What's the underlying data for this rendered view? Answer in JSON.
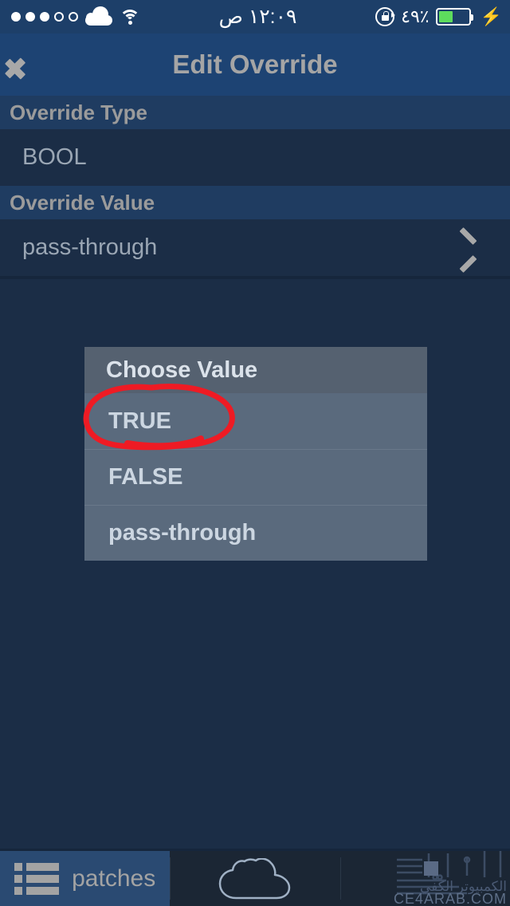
{
  "status_bar": {
    "signal_dots_filled": 3,
    "signal_dots_total": 5,
    "carrier_icon": "cloud-icon",
    "wifi_icon": "wifi-icon",
    "time": "١٢:٠٩ ص",
    "rotation_lock_icon": "rotation-lock-icon",
    "battery_percent_label": "٪٤٩",
    "battery_fill_percent": 49,
    "charging_bolt": "⚡",
    "text_color": "#ffffff",
    "background": "#1d3f69"
  },
  "nav_bar": {
    "back_icon": "chevron-left-icon",
    "title": "Edit Override",
    "background": "#1d4373",
    "title_color": "#a5a5a5"
  },
  "sections": [
    {
      "header": "Override Type",
      "cell_value": "BOOL",
      "has_chevron": false
    },
    {
      "header": "Override Value",
      "cell_value": "pass-through",
      "has_chevron": true
    }
  ],
  "dialog": {
    "title": "Choose Value",
    "options": [
      {
        "label": "TRUE",
        "highlighted": true
      },
      {
        "label": "FALSE",
        "highlighted": false
      },
      {
        "label": "pass-through",
        "highlighted": false
      }
    ],
    "background": "#5a6a7d",
    "header_background": "#556170"
  },
  "annotation": {
    "shape": "ellipse",
    "color": "#ee1b24",
    "targets": "TRUE"
  },
  "tab_bar": {
    "tabs": [
      {
        "label": "patches",
        "icon": "list-icon",
        "active": true
      },
      {
        "label": "",
        "icon": "cloud-icon",
        "active": false
      },
      {
        "label": "",
        "icon": "watermark",
        "active": false
      }
    ],
    "active_background": "#2a4a72",
    "background": "#1b2634"
  },
  "watermark": {
    "arabic": "الكمبيوتر الكفي",
    "url": "CE4ARAB.COM"
  },
  "colors": {
    "page_background": "#1b2d46",
    "section_header_background": "#1f3c61",
    "cell_text": "#9aa6b4"
  }
}
